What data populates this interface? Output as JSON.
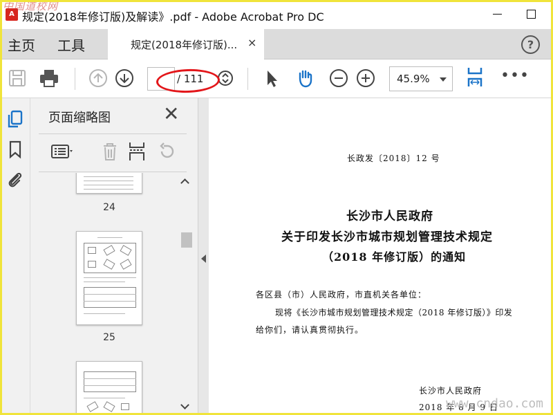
{
  "window": {
    "title": "规定(2018年修订版)及解读》.pdf - Adobe Acrobat Pro DC",
    "watermark_top": "中国道校网"
  },
  "tabs": {
    "home": "主页",
    "tools": "工具",
    "document": "规定(2018年修订版)...",
    "close": "×",
    "help": "?"
  },
  "toolbar": {
    "page_current": "",
    "page_total": "/ 111",
    "zoom": "45.9%",
    "more": "•••"
  },
  "thumbnails": {
    "title": "页面缩略图",
    "close": "✕",
    "pages": [
      {
        "label": "24"
      },
      {
        "label": "25"
      }
    ]
  },
  "document": {
    "ref_number": "长政发〔2018〕12 号",
    "title_line1": "长沙市人民政府",
    "title_line2": "关于印发长沙市城市规划管理技术规定",
    "title_line3": "（2018 年修订版）的通知",
    "para1": "各区县（市）人民政府，市直机关各单位：",
    "para2": "现将《长沙市城市规划管理技术规定（2018 年修订版）》印发",
    "para3": "给你们，请认真贯彻执行。",
    "signature": "长沙市人民政府",
    "date": "2018 年 8 月 9 日"
  },
  "watermark_bottom": "www.cndao.com",
  "colors": {
    "accent_blue": "#1a73c8",
    "highlight_red": "#e3161a",
    "frame_yellow": "#f0e43a"
  },
  "icons": [
    "save-icon",
    "print-icon",
    "page-up-icon",
    "page-down-icon",
    "page-stepper-icon",
    "select-arrow-icon",
    "hand-icon",
    "zoom-out-icon",
    "zoom-in-icon",
    "fit-width-icon",
    "thumbnails-icon",
    "bookmark-icon",
    "attachment-icon",
    "options-icon",
    "delete-icon",
    "insert-page-icon",
    "rotate-icon"
  ]
}
